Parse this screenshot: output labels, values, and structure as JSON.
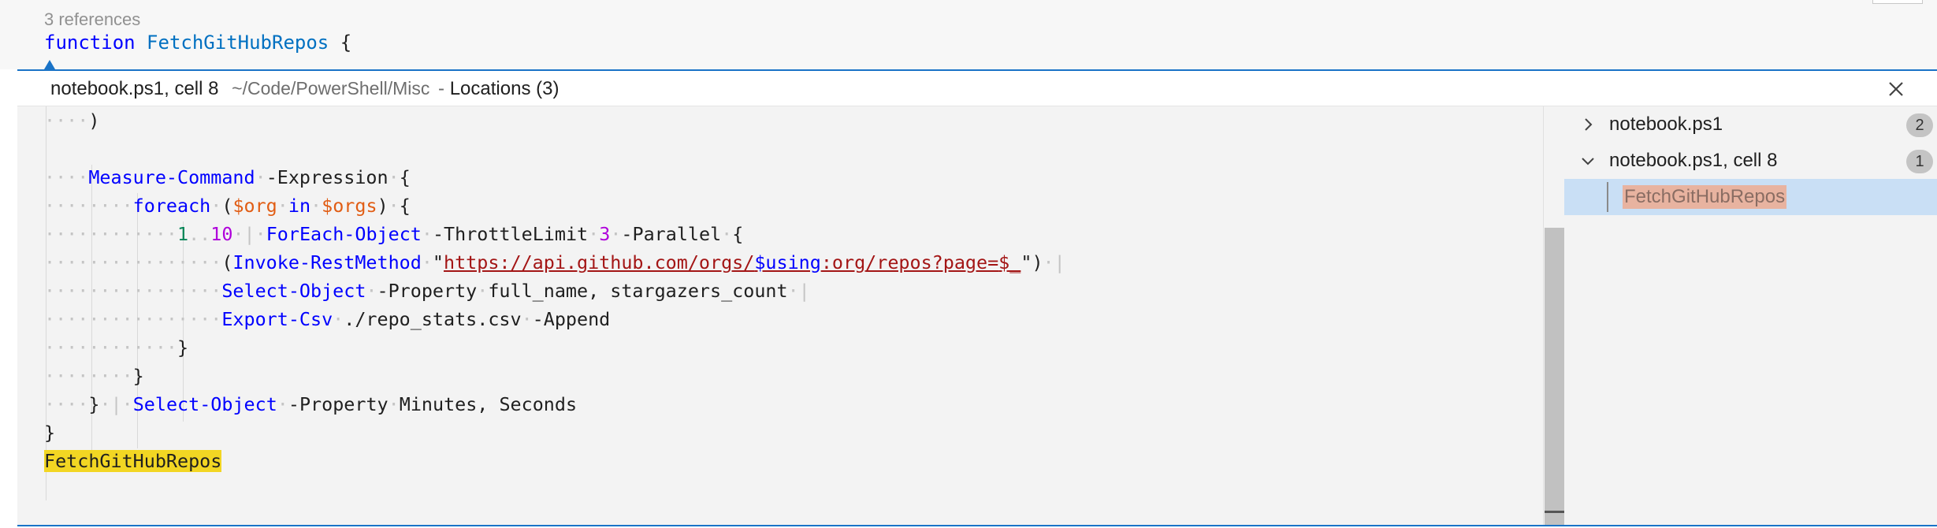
{
  "editor": {
    "codelens": "3 references",
    "function_keyword": "function",
    "function_name": "FetchGitHubRepos",
    "open_brace": "{"
  },
  "peek": {
    "header": {
      "file": "notebook.ps1, cell 8",
      "path": "~/Code/PowerShell/Misc",
      "separator": "-",
      "locations": "Locations (3)"
    },
    "code": {
      "l1_close_paren": ")",
      "l2_measure": "Measure-Command",
      "l2_expression": "-Expression",
      "l2_brace": "{",
      "l3_foreach": "foreach",
      "l3_paren_open": "(",
      "l3_var_org": "$org",
      "l3_in": "in",
      "l3_var_orgs": "$orgs",
      "l3_paren_close": ")",
      "l3_brace": "{",
      "l4_range_start": "1",
      "l4_range_op": "..",
      "l4_range_end": "10",
      "l4_pipe": "|",
      "l4_foreach_object": "ForEach-Object",
      "l4_throttle": "-ThrottleLimit",
      "l4_three": "3",
      "l4_parallel": "-Parallel",
      "l4_brace": "{",
      "l5_paren_open": "(",
      "l5_invoke": "Invoke-RestMethod",
      "l5_quote_open": "\"",
      "l5_url_start": "https://api.github.com/orgs/",
      "l5_using": "$using",
      "l5_colon_org": ":org",
      "l5_url_end": "/repos?page=",
      "l5_dollar_underscore": "$_",
      "l5_quote_close": "\"",
      "l5_paren_close": ")",
      "l5_pipe": "|",
      "l6_select": "Select-Object",
      "l6_property": "-Property",
      "l6_args": "full_name, stargazers_count",
      "l6_pipe": "|",
      "l7_export": "Export-Csv",
      "l7_path": "./repo_stats.csv",
      "l7_append": "-Append",
      "l8_brace": "}",
      "l9_brace": "}",
      "l10_brace": "}",
      "l10_pipe": "|",
      "l10_select": "Select-Object",
      "l10_property": "-Property",
      "l10_args": "Minutes, Seconds",
      "l11_brace": "}",
      "l12_call": "FetchGitHubRepos"
    },
    "tree": {
      "items": [
        {
          "label": "notebook.ps1",
          "count": "2",
          "expanded": false
        },
        {
          "label": "notebook.ps1, cell 8",
          "count": "1",
          "expanded": true
        }
      ],
      "reference": "FetchGitHubRepos"
    }
  },
  "icons": {
    "close": "close-icon",
    "collapsed": "chevron-right-icon",
    "expanded": "chevron-down-icon"
  },
  "colors": {
    "accent": "#1a73c7",
    "highlight": "#f2d623",
    "selection": "#c9dff5"
  }
}
